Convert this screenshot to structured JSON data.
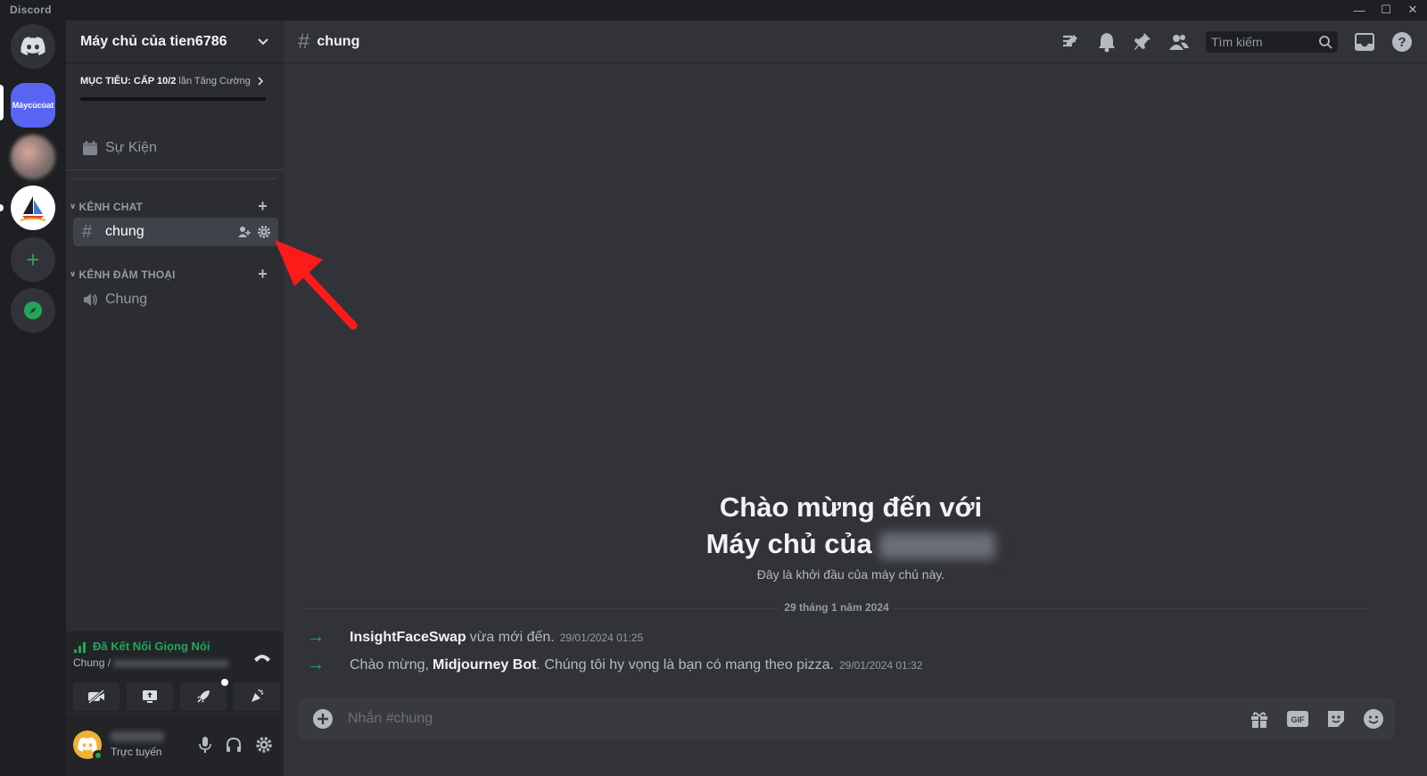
{
  "app": {
    "name": "Discord"
  },
  "rail": {
    "selected_server_label": "Máycủcủat"
  },
  "server": {
    "name": "Máy chủ của tien6786",
    "boost": {
      "goal": "MỤC TIÊU: CẤP 1",
      "progress_text": "0/2",
      "suffix": "lần Tăng Cường",
      "progress": 0
    }
  },
  "sidebar": {
    "events_label": "Sự Kiện",
    "categories": [
      {
        "label": "KÊNH CHAT",
        "channels": [
          {
            "name": "chung",
            "type": "text",
            "active": true
          }
        ]
      },
      {
        "label": "KÊNH ĐÀM THOẠI",
        "channels": [
          {
            "name": "Chung",
            "type": "voice",
            "active": false
          }
        ]
      }
    ]
  },
  "voice": {
    "status": "Đã Kết Nối Giọng Nói",
    "channel": "Chung /"
  },
  "user": {
    "status": "Trực tuyến"
  },
  "main": {
    "channel_name": "chung",
    "search_placeholder": "Tìm kiếm",
    "welcome_line1": "Chào mừng đến với",
    "welcome_line2": "Máy chủ của",
    "welcome_sub": "Đây là khởi đầu của máy chủ này.",
    "date_divider": "29 tháng 1 năm 2024",
    "messages": [
      {
        "user": "InsightFaceSwap",
        "pre": "",
        "text": "vừa mới đến.",
        "timestamp": "29/01/2024 01:25"
      },
      {
        "user": "Midjourney Bot",
        "pre": "Chào mừng,",
        "text": ". Chúng tôi hy vọng là bạn có mang theo pizza.",
        "timestamp": "29/01/2024 01:32"
      }
    ],
    "composer_placeholder": "Nhắn #chung"
  },
  "colors": {
    "green": "#23a55a",
    "blurple": "#5865f2",
    "red_arrow": "#ff1a1a"
  }
}
